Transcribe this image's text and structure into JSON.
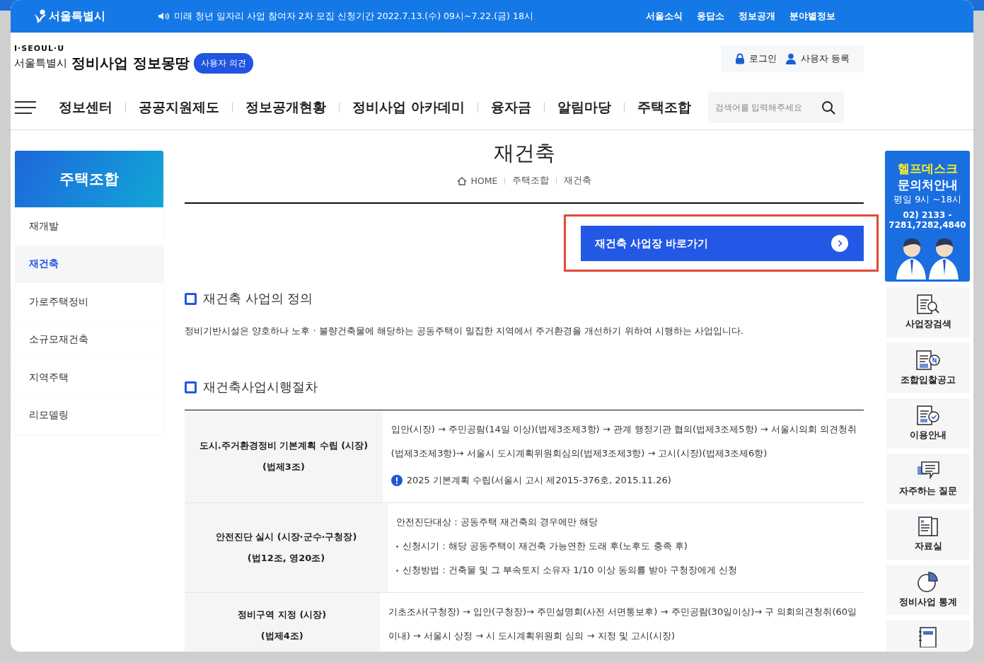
{
  "top_bar": {
    "city": "서울특별시",
    "notice": "미래 청년 일자리 사업 참여자 2차 모집 신청기간 2022.7.13.(수) 09시~7.22.(금) 18시",
    "links": [
      "서울소식",
      "응답소",
      "정보공개",
      "분야별정보"
    ]
  },
  "header": {
    "logo_small": "I·SEOUL·U",
    "logo_city": "서울특별시",
    "site_title": "정비사업 정보몽땅",
    "feedback_button": "사용자 의견",
    "login": "로그인",
    "register": "사용자 등록"
  },
  "nav": {
    "items": [
      {
        "label": "정보센터",
        "selected": false
      },
      {
        "label": "공공지원제도",
        "selected": false
      },
      {
        "label": "정보공개현황",
        "selected": false
      },
      {
        "label": "정비사업 아카데미",
        "selected": false
      },
      {
        "label": "융자금",
        "selected": false
      },
      {
        "label": "알림마당",
        "selected": false
      },
      {
        "label": "주택조합",
        "selected": false
      }
    ],
    "search_placeholder": "검색어를 입력해주세요"
  },
  "sidebar": {
    "title": "주택조합",
    "items": [
      {
        "label": "재개발",
        "selected": false
      },
      {
        "label": "재건축",
        "selected": true
      },
      {
        "label": "가로주택정비",
        "selected": false
      },
      {
        "label": "소규모재건축",
        "selected": false
      },
      {
        "label": "지역주택",
        "selected": false
      },
      {
        "label": "리모델링",
        "selected": false
      }
    ]
  },
  "page_title": "재건축",
  "breadcrumb": [
    "HOME",
    "주택조합",
    "재건축"
  ],
  "shortcut_button": "재건축 사업장 바로가기",
  "sections": [
    {
      "heading": "재건축 사업의 정의",
      "text": "정비기반시설은 양호하나 노후 · 불량건축물에 해당하는 공동주택이 밀집한 지역에서 주거환경을 개선하기 위하여 시행하는 사업입니다."
    },
    {
      "heading": "재건축사업시행절차"
    }
  ],
  "procedure_table": {
    "rows": [
      {
        "step": [
          "도시.주거환경정비 기본계획 수립 (시장)",
          "(법제3조)"
        ],
        "lines": [
          {
            "kind": "plain",
            "text": "입안(시장) → 주민공람(14일 이상)(법제3조제3항) → 관계 행정기관 협의(법제3조제5항) → 서울시의회 의견청취"
          },
          {
            "kind": "plain",
            "text": "(법제3조제3항)→ 서울시 도시계획위원회심의(법제3조제3항) → 고시(시장)(법제3조제6항)"
          },
          {
            "kind": "notice",
            "text": "2025 기본계획 수립(서울시 고시 제2015-376호, 2015.11.26)"
          }
        ]
      },
      {
        "step": [
          "안전진단 실시 (시장·군수·구청장)",
          "(법12조, 영20조)"
        ],
        "lines": [
          {
            "kind": "plain",
            "text": "안전진단대상 : 공동주택 재건축의 경우에만 해당"
          },
          {
            "kind": "bullet",
            "text": "신청시기 : 해당 공동주택이 재건축 가능연한 도래 후(노후도 충족 후)"
          },
          {
            "kind": "bullet",
            "text": "신청방법 : 건축물 및 그 부속토지 소유자 1/10 이상 동의를 받아 구청장에게 신청"
          }
        ]
      },
      {
        "step": [
          "정비구역 지정 (시장)",
          "(법제4조)"
        ],
        "lines": [
          {
            "kind": "plain",
            "text": "기초조사(구청장) → 입안(구청장)→ 주민설명회(사전 서면통보후) → 주민공람(30일이상)→ 구 의회의견청취(60일"
          },
          {
            "kind": "plain",
            "text": "이내) → 서울시 상정 → 시 도시계획위원회 심의 → 지정 및 고시(시장)"
          }
        ]
      }
    ]
  },
  "helpdesk": {
    "title": [
      "헬프데스크",
      "문의처안내"
    ],
    "hours": "평일 9시 ~18시",
    "phone": [
      "02) 2133 -",
      "7281,7282,4840"
    ]
  },
  "quick_menu": [
    {
      "kind": "search",
      "label": "사업장검색"
    },
    {
      "kind": "notice",
      "label": "조합입찰공고"
    },
    {
      "kind": "guide",
      "label": "이용안내"
    },
    {
      "kind": "faq",
      "label": "자주하는 질문"
    },
    {
      "kind": "archive",
      "label": "자료실"
    },
    {
      "kind": "stats",
      "label": "정비사업 통계"
    },
    {
      "kind": "book"
    }
  ]
}
